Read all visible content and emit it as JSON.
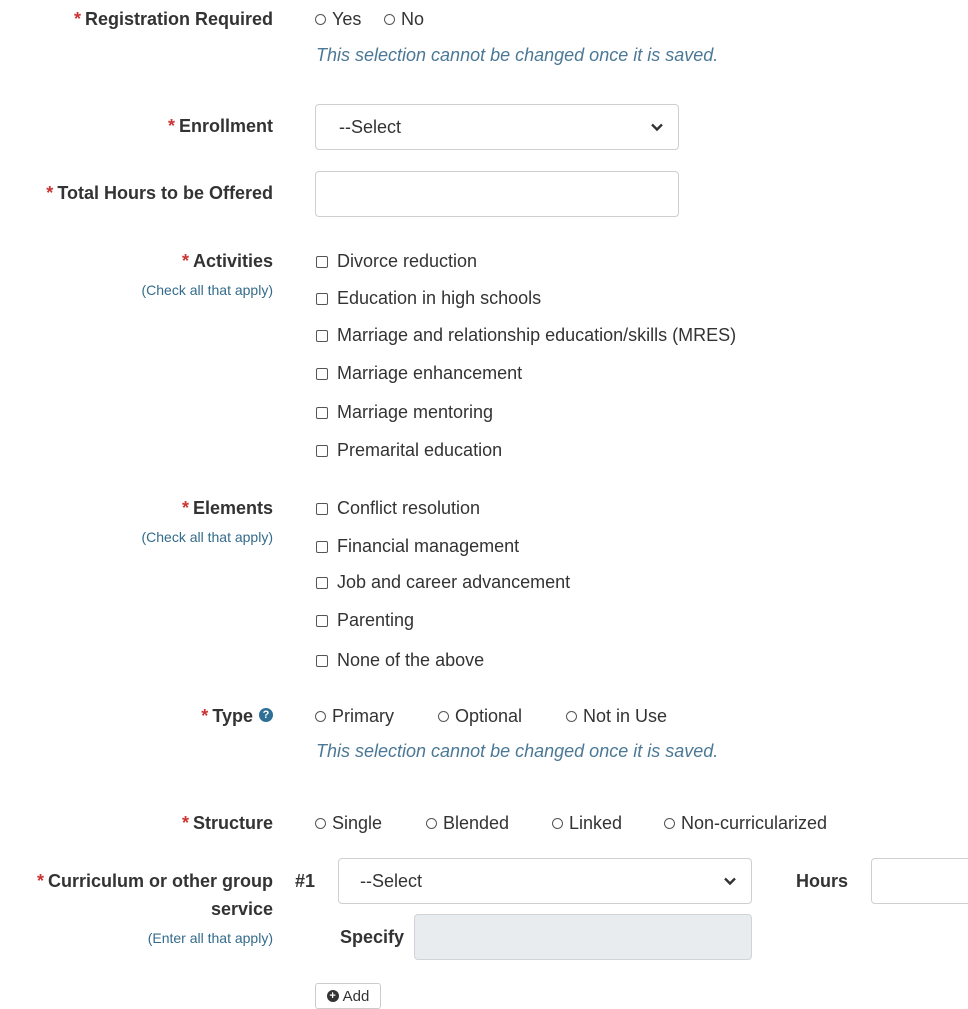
{
  "required_marker": "*",
  "registration": {
    "label": "Registration Required",
    "options": [
      "Yes",
      "No"
    ],
    "note": "This selection cannot be changed once it is saved."
  },
  "enrollment": {
    "label": "Enrollment",
    "value": "--Select"
  },
  "total_hours": {
    "label": "Total Hours to be Offered",
    "value": ""
  },
  "activities": {
    "label": "Activities",
    "hint": "(Check all that apply)",
    "options": [
      "Divorce reduction",
      "Education in high schools",
      "Marriage and relationship education/skills (MRES)",
      "Marriage enhancement",
      "Marriage mentoring",
      "Premarital education"
    ]
  },
  "elements": {
    "label": "Elements",
    "hint": "(Check all that apply)",
    "options": [
      "Conflict resolution",
      "Financial management",
      "Job and career advancement",
      "Parenting",
      "None of the above"
    ]
  },
  "type": {
    "label": "Type",
    "help_icon": "question-circle-icon",
    "options": [
      "Primary",
      "Optional",
      "Not in Use"
    ],
    "note": "This selection cannot be changed once it is saved."
  },
  "structure": {
    "label": "Structure",
    "options": [
      "Single",
      "Blended",
      "Linked",
      "Non-curricularized"
    ]
  },
  "curriculum": {
    "label_line1": "Curriculum or other group",
    "label_line2": "service",
    "hint": "(Enter all that apply)",
    "index": "#1",
    "select_value": "--Select",
    "hours_label": "Hours",
    "hours_value": "",
    "specify_label": "Specify",
    "specify_value": "",
    "add_label": "Add",
    "add_icon": "plus-circle-icon"
  },
  "colors": {
    "required": "#cc3333",
    "hint": "#336b8a",
    "note": "#4a7896",
    "text": "#333333"
  }
}
